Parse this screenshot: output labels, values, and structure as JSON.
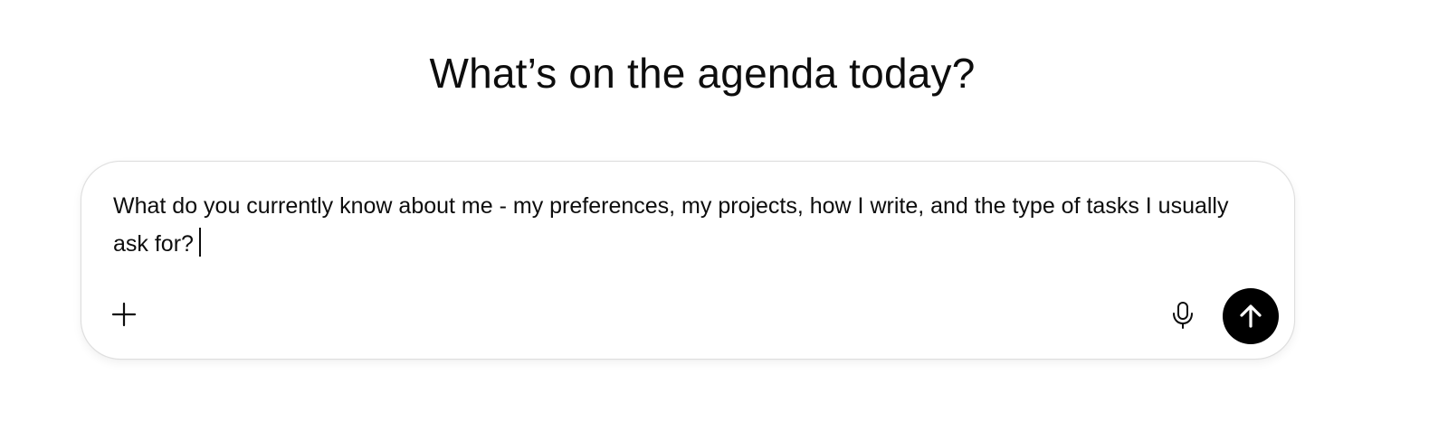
{
  "heading": "What’s on the agenda today?",
  "composer": {
    "input_value": "What do you currently know about me - my preferences, my projects, how I write, and the type of tasks I usually ask for?",
    "attach_icon": "plus-icon",
    "voice_icon": "microphone-icon",
    "send_icon": "arrow-up-icon"
  },
  "colors": {
    "background": "#ffffff",
    "text": "#0d0d0d",
    "send_button": "#000000",
    "composer_border": "#dedede"
  }
}
